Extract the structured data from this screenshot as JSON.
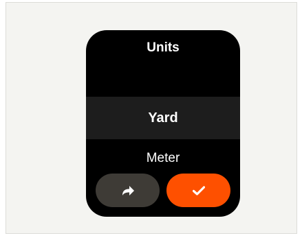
{
  "screen": {
    "title": "Units"
  },
  "picker": {
    "selected": "Yard",
    "next": "Meter"
  },
  "actions": {
    "forward_icon": "forward-arrow-icon",
    "confirm_icon": "checkmark-icon"
  },
  "colors": {
    "watch_background": "#000000",
    "selected_row": "#1d1d1d",
    "forward_button": "#3e3b36",
    "confirm_button": "#fe5000",
    "text": "#ffffff"
  }
}
